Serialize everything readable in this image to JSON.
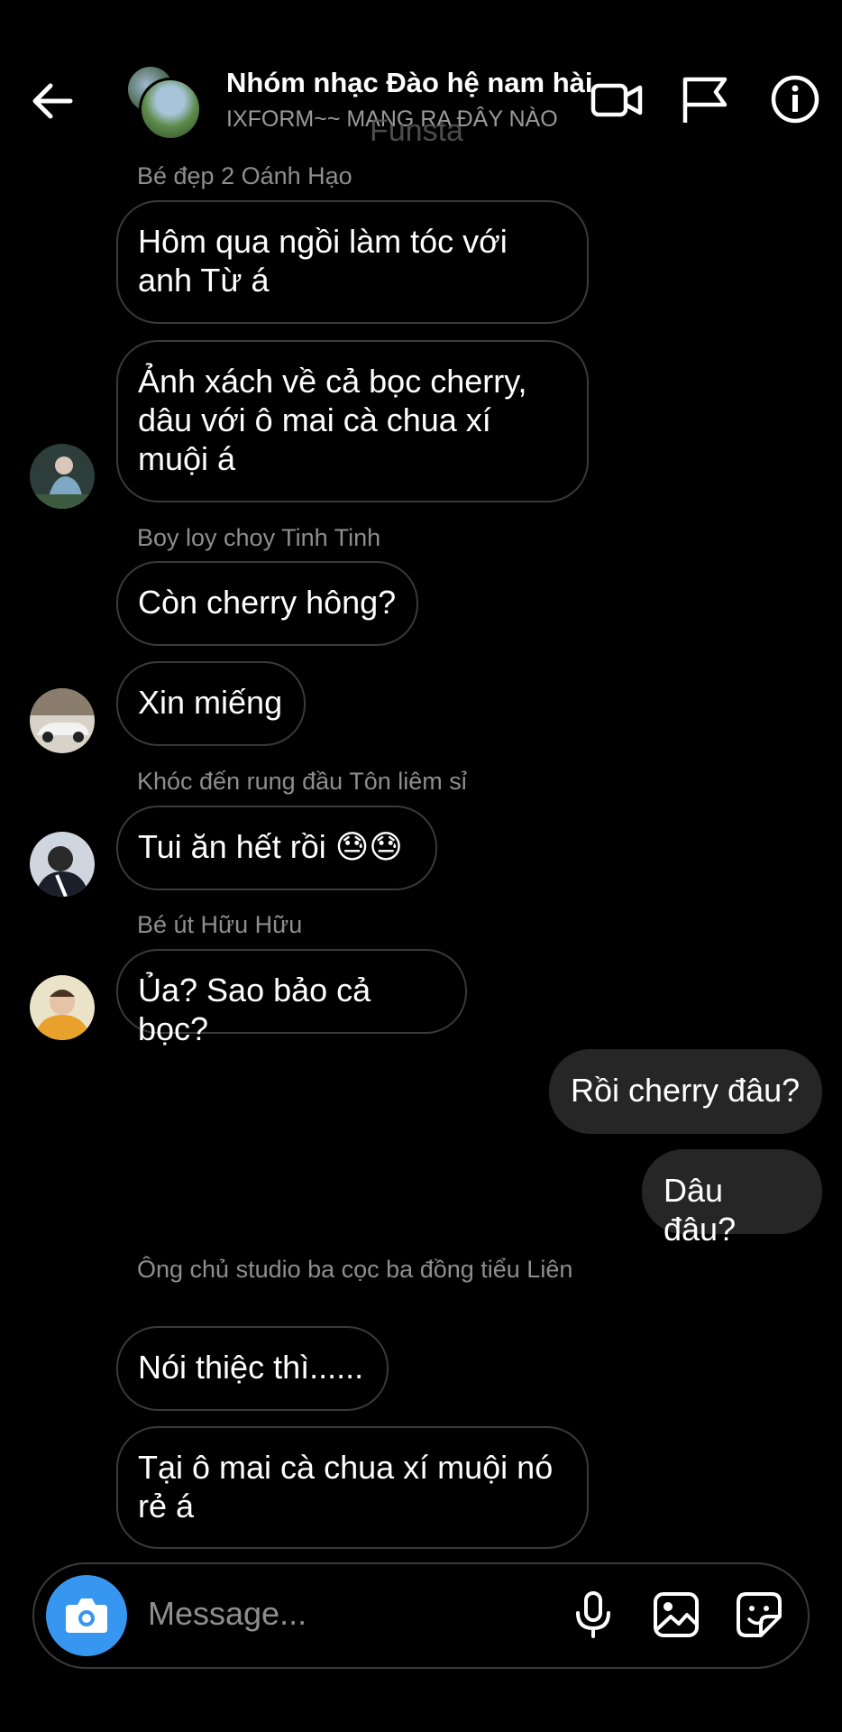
{
  "header": {
    "title": "Nhóm nhạc Đào hệ nam hài",
    "subtitle": "IXFORM~~ MANG RA ĐÂY NÀO",
    "watermark": "Funsta"
  },
  "messages": [
    {
      "sender": "Bé đẹp 2 Oánh Hạo",
      "text": "Hôm qua ngồi làm tóc với anh Từ á"
    },
    {
      "text": "Ảnh xách về cả bọc cherry, dâu với ô mai cà chua xí muội á"
    },
    {
      "sender": "Boy loy choy Tinh Tinh",
      "text": "Còn cherry hông?"
    },
    {
      "text": "Xin miếng"
    },
    {
      "sender": "Khóc đến rung đầu Tôn liêm sỉ",
      "text": "Tui ăn hết rồi 😓😓"
    },
    {
      "sender": "Bé út Hữu Hữu",
      "text": "Ủa? Sao bảo cả bọc?"
    },
    {
      "text": "Rồi cherry đâu?",
      "outgoing": true
    },
    {
      "text": "Dâu đâu?",
      "outgoing": true
    },
    {
      "sender": "Ông chủ studio ba cọc ba đồng tiểu Liên",
      "text": "Nói thiệc thì......"
    },
    {
      "text": "Tại ô mai cà chua xí muội nó rẻ á"
    }
  ],
  "composer": {
    "placeholder": "Message..."
  },
  "colors": {
    "background": "#000000",
    "accent": "#3797f0",
    "outgoing_bubble": "#262626",
    "incoming_border": "#3a3a3a"
  },
  "icons": [
    "back-arrow-icon",
    "video-call-icon",
    "flag-icon",
    "info-icon",
    "camera-icon",
    "microphone-icon",
    "gallery-icon",
    "sticker-icon"
  ]
}
